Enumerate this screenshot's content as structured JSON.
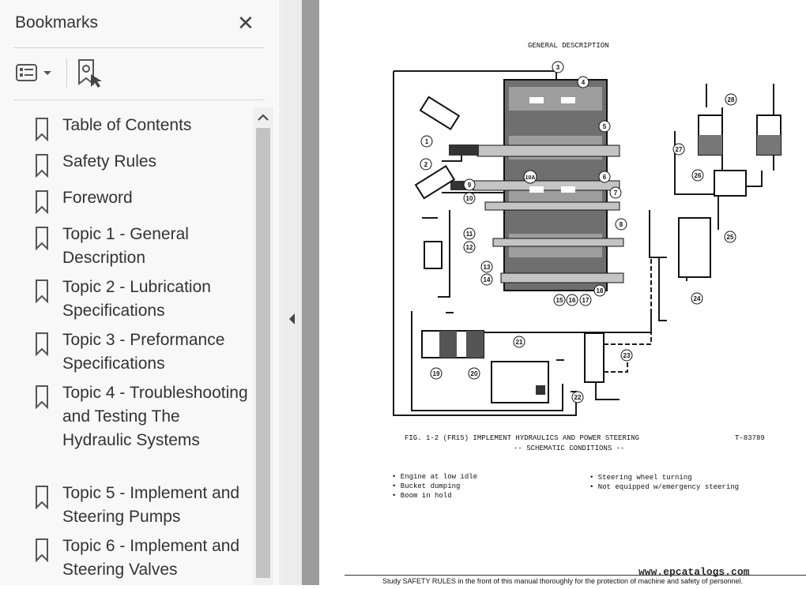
{
  "sidebar": {
    "title": "Bookmarks",
    "close_icon": "close-icon",
    "options_icon": "bookmark-options-icon",
    "add_icon": "add-bookmark-icon",
    "items": [
      {
        "label": "Table of Contents"
      },
      {
        "label": "Safety Rules"
      },
      {
        "label": "Foreword"
      },
      {
        "label": "Topic 1 - General Description"
      },
      {
        "label": "Topic 2 - Lubrication Specifications"
      },
      {
        "label": "Topic 3 - Preformance Specifications"
      },
      {
        "label": "Topic 4 - Troubleshooting and Testing The Hydraulic Systems"
      },
      {
        "label": "Topic 5 - Implement and Steering Pumps"
      },
      {
        "label": "Topic 6 - Implement and Steering Valves"
      }
    ]
  },
  "document": {
    "header": "GENERAL DESCRIPTION",
    "figure_caption": "FIG. 1-2 (FR15) IMPLEMENT HYDRAULICS AND POWER STEERING",
    "figure_subcaption": "-- SCHEMATIC CONDITIONS --",
    "figure_id": "T-83789",
    "conditions_left": [
      "• Engine at low idle",
      "• Bucket dumping",
      "• Boom in hold"
    ],
    "conditions_right": [
      "• Steering wheel turning",
      "• Not equipped w/emergency steering"
    ],
    "callouts": [
      "1",
      "2",
      "3",
      "4",
      "5",
      "6",
      "7",
      "8",
      "9",
      "10",
      "10A",
      "11",
      "12",
      "13",
      "14",
      "15",
      "16",
      "17",
      "18",
      "19",
      "20",
      "21",
      "22",
      "23",
      "24",
      "25",
      "26",
      "27",
      "28"
    ],
    "footer": "Study SAFETY RULES in the front of this manual thoroughly for the protection of machine and safety of personnel.",
    "watermark": "www.epcatalogs.com"
  },
  "colors": {
    "sidebar_bg": "#f8f8f8",
    "text": "#333333",
    "scroll_thumb": "#c2c2c2",
    "gutter": "#9c9c9c"
  }
}
